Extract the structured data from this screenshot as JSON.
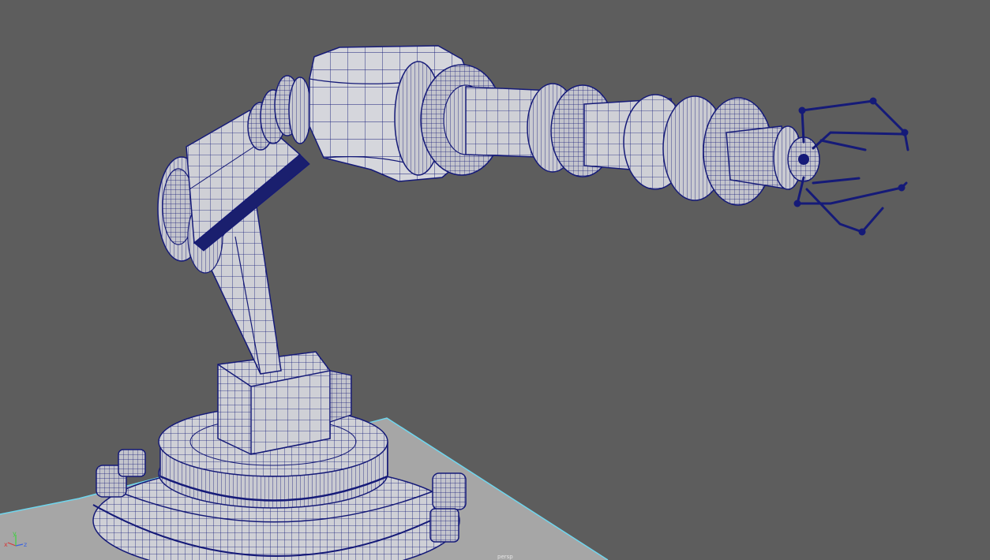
{
  "viewport": {
    "background": "#5d5d5d",
    "camera_label": "persp"
  },
  "model": {
    "name": "robot-arm-wireframe",
    "fill_color": "#cfd0d6",
    "wire_color": "#151a78",
    "ground_color": "#a6a6a6",
    "ground_edge_color": "#6fd6ee"
  },
  "axis_gizmo": {
    "x_label": "x",
    "y_label": "y",
    "z_label": "z",
    "x_color": "#d43a3a",
    "y_color": "#3fd13f",
    "z_color": "#3a64e0"
  }
}
